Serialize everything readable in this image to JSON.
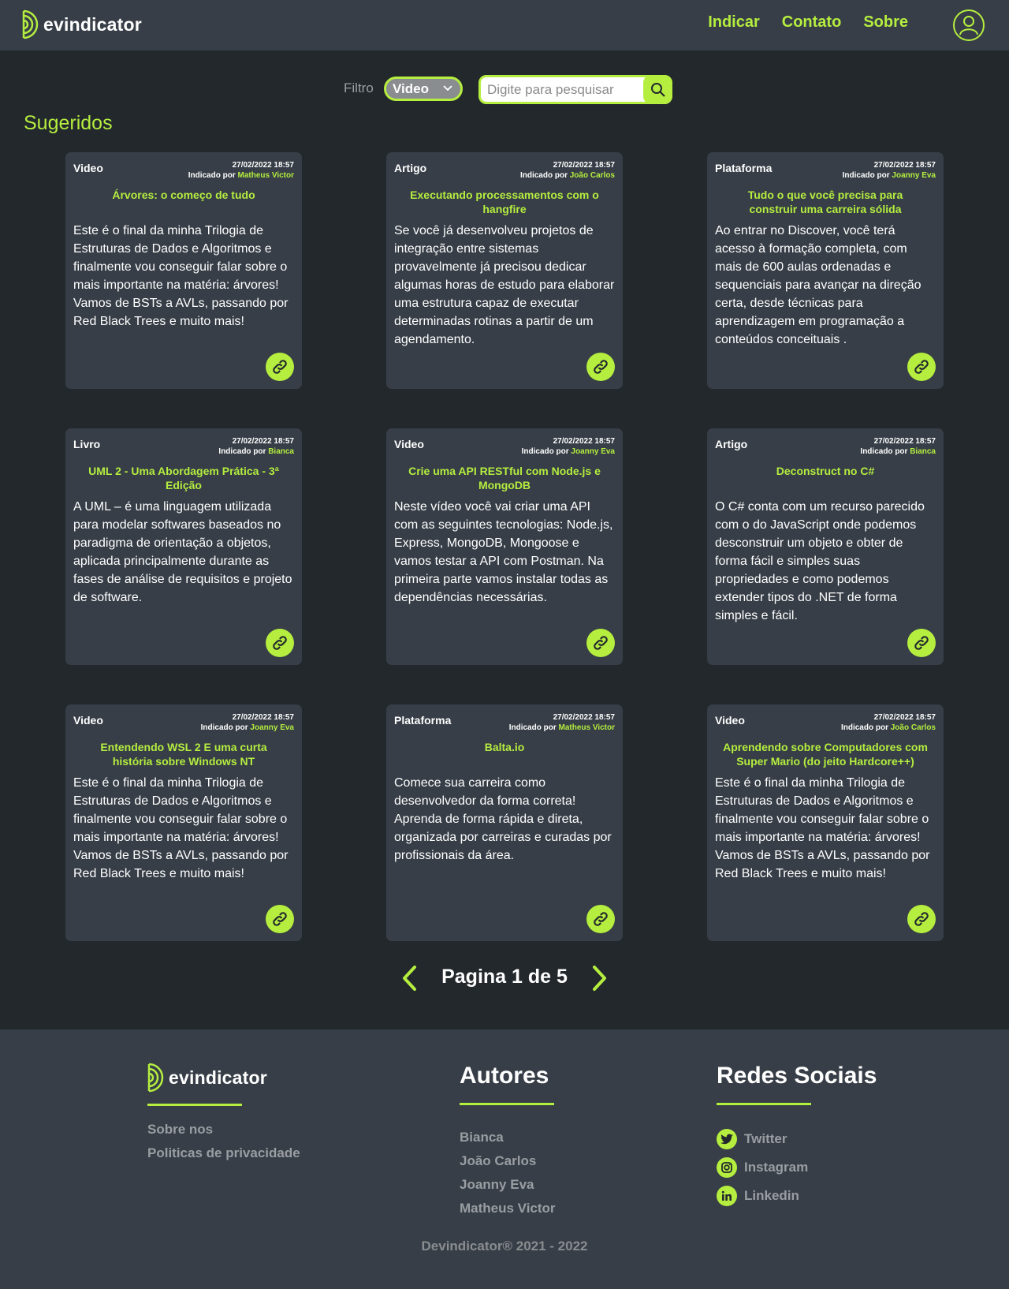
{
  "header": {
    "logo_text": "evindicator",
    "nav": [
      "Indicar",
      "Contato",
      "Sobre"
    ]
  },
  "filter": {
    "label": "Filtro",
    "selected": "Video",
    "search_placeholder": "Digite para pesquisar"
  },
  "section_title": "Sugeridos",
  "cards": [
    {
      "type": "Video",
      "date": "27/02/2022 18:57",
      "indicated_label": "Indicado por",
      "author": "Matheus Victor",
      "title": "Árvores: o começo de tudo",
      "description": "Este é o final da minha Trilogia de Estruturas de Dados e Algoritmos e finalmente vou conseguir falar sobre o mais importante na matéria: árvores! Vamos de BSTs a AVLs, passando por Red Black Trees e muito mais!"
    },
    {
      "type": "Artigo",
      "date": "27/02/2022 18:57",
      "indicated_label": "Indicado por",
      "author": "João Carlos",
      "title": "Executando processamentos com o hangfire",
      "description": "Se você já desenvolveu projetos de integração entre sistemas provavelmente já precisou dedicar algumas horas de estudo para elaborar uma estrutura capaz de executar determinadas rotinas a partir de um agendamento."
    },
    {
      "type": "Plataforma",
      "date": "27/02/2022 18:57",
      "indicated_label": "Indicado por",
      "author": "Joanny Eva",
      "title": "Tudo o que você precisa para construir uma carreira sólida",
      "description": "Ao entrar no Discover, você terá acesso à formação completa, com mais de 600 aulas ordenadas e sequenciais para avançar na direção certa, desde técnicas para aprendizagem em programação a conteúdos conceituais ."
    },
    {
      "type": "Livro",
      "date": "27/02/2022 18:57",
      "indicated_label": "Indicado por",
      "author": "Bianca",
      "title": "UML 2 - Uma Abordagem Prática - 3ª Edição",
      "description": "A UML – é uma linguagem utilizada para modelar softwares baseados no paradigma de orientação a objetos, aplicada principalmente durante as fases de análise de requisitos e projeto de software."
    },
    {
      "type": "Video",
      "date": "27/02/2022 18:57",
      "indicated_label": "Indicado por",
      "author": "Joanny Eva",
      "title": "Crie uma API RESTful com Node.js e MongoDB",
      "description": "Neste vídeo você vai criar uma API com as seguintes tecnologias: Node.js, Express, MongoDB, Mongoose e vamos testar a API com Postman. Na primeira parte vamos instalar todas as dependências necessárias."
    },
    {
      "type": "Artigo",
      "date": "27/02/2022 18:57",
      "indicated_label": "Indicado por",
      "author": "Bianca",
      "title": "Deconstruct no C#",
      "description": "O C# conta com um recurso parecido com o do JavaScript onde podemos desconstruir um objeto e obter de forma fácil e simples suas propriedades e como podemos extender tipos do .NET de forma simples e fácil."
    },
    {
      "type": "Video",
      "date": "27/02/2022 18:57",
      "indicated_label": "Indicado por",
      "author": "Joanny Eva",
      "title": "Entendendo WSL 2 E uma curta história sobre Windows NT",
      "description": "Este é o final da minha Trilogia de Estruturas de Dados e Algoritmos e finalmente vou conseguir falar sobre o mais importante na matéria: árvores! Vamos de BSTs a AVLs, passando por Red Black Trees e muito mais!"
    },
    {
      "type": "Plataforma",
      "date": "27/02/2022 18:57",
      "indicated_label": "Indicado por",
      "author": "Matheus Victor",
      "title": "Balta.io",
      "description": "Comece sua carreira como desenvolvedor da forma correta! Aprenda de forma rápida e direta, organizada por carreiras e curadas por profissionais da área."
    },
    {
      "type": "Video",
      "date": "27/02/2022 18:57",
      "indicated_label": "Indicado por",
      "author": "João Carlos",
      "title": "Aprendendo sobre Computadores com Super Mario (do jeito Hardcore++)",
      "description": "Este é o final da minha Trilogia de Estruturas de Dados e Algoritmos e finalmente vou conseguir falar sobre o mais importante na matéria: árvores! Vamos de BSTs a AVLs, passando por Red Black Trees e muito mais!"
    }
  ],
  "pagination": {
    "label": "Pagina 1 de 5"
  },
  "footer": {
    "logo_text": "evindicator",
    "links": [
      "Sobre nos",
      "Politicas de privacidade"
    ],
    "authors_title": "Autores",
    "authors": [
      "Bianca",
      "João Carlos",
      "Joanny Eva",
      "Matheus Victor"
    ],
    "social_title": "Redes Sociais",
    "social": [
      "Twitter",
      "Instagram",
      "Linkedin"
    ],
    "copyright": "Devindicator®   2021 - 2022"
  },
  "colors": {
    "accent": "#b5ee3f",
    "background": "#23282d",
    "panel": "#373e47"
  }
}
